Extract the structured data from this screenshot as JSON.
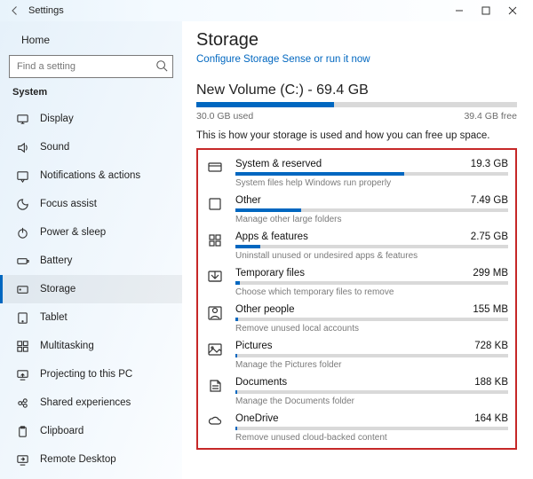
{
  "window": {
    "title": "Settings"
  },
  "sidebar": {
    "home": "Home",
    "search_placeholder": "Find a setting",
    "section": "System",
    "items": [
      {
        "label": "Display"
      },
      {
        "label": "Sound"
      },
      {
        "label": "Notifications & actions"
      },
      {
        "label": "Focus assist"
      },
      {
        "label": "Power & sleep"
      },
      {
        "label": "Battery"
      },
      {
        "label": "Storage"
      },
      {
        "label": "Tablet"
      },
      {
        "label": "Multitasking"
      },
      {
        "label": "Projecting to this PC"
      },
      {
        "label": "Shared experiences"
      },
      {
        "label": "Clipboard"
      },
      {
        "label": "Remote Desktop"
      }
    ]
  },
  "page": {
    "title": "Storage",
    "configure_link": "Configure Storage Sense or run it now",
    "volume_title": "New Volume (C:) - 69.4 GB",
    "used_label": "30.0 GB used",
    "free_label": "39.4 GB free",
    "used_pct": 43,
    "intro": "This is how your storage is used and how you can free up space.",
    "categories": [
      {
        "name": "System & reserved",
        "size": "19.3 GB",
        "pct": 62,
        "desc": "System files help Windows run properly"
      },
      {
        "name": "Other",
        "size": "7.49 GB",
        "pct": 24,
        "desc": "Manage other large folders"
      },
      {
        "name": "Apps & features",
        "size": "2.75 GB",
        "pct": 9,
        "desc": "Uninstall unused or undesired apps & features"
      },
      {
        "name": "Temporary files",
        "size": "299 MB",
        "pct": 1.5,
        "desc": "Choose which temporary files to remove"
      },
      {
        "name": "Other people",
        "size": "155 MB",
        "pct": 1,
        "desc": "Remove unused local accounts"
      },
      {
        "name": "Pictures",
        "size": "728 KB",
        "pct": 0.5,
        "desc": "Manage the Pictures folder"
      },
      {
        "name": "Documents",
        "size": "188 KB",
        "pct": 0.5,
        "desc": "Manage the Documents folder"
      },
      {
        "name": "OneDrive",
        "size": "164 KB",
        "pct": 0.5,
        "desc": "Remove unused cloud-backed content"
      }
    ]
  }
}
